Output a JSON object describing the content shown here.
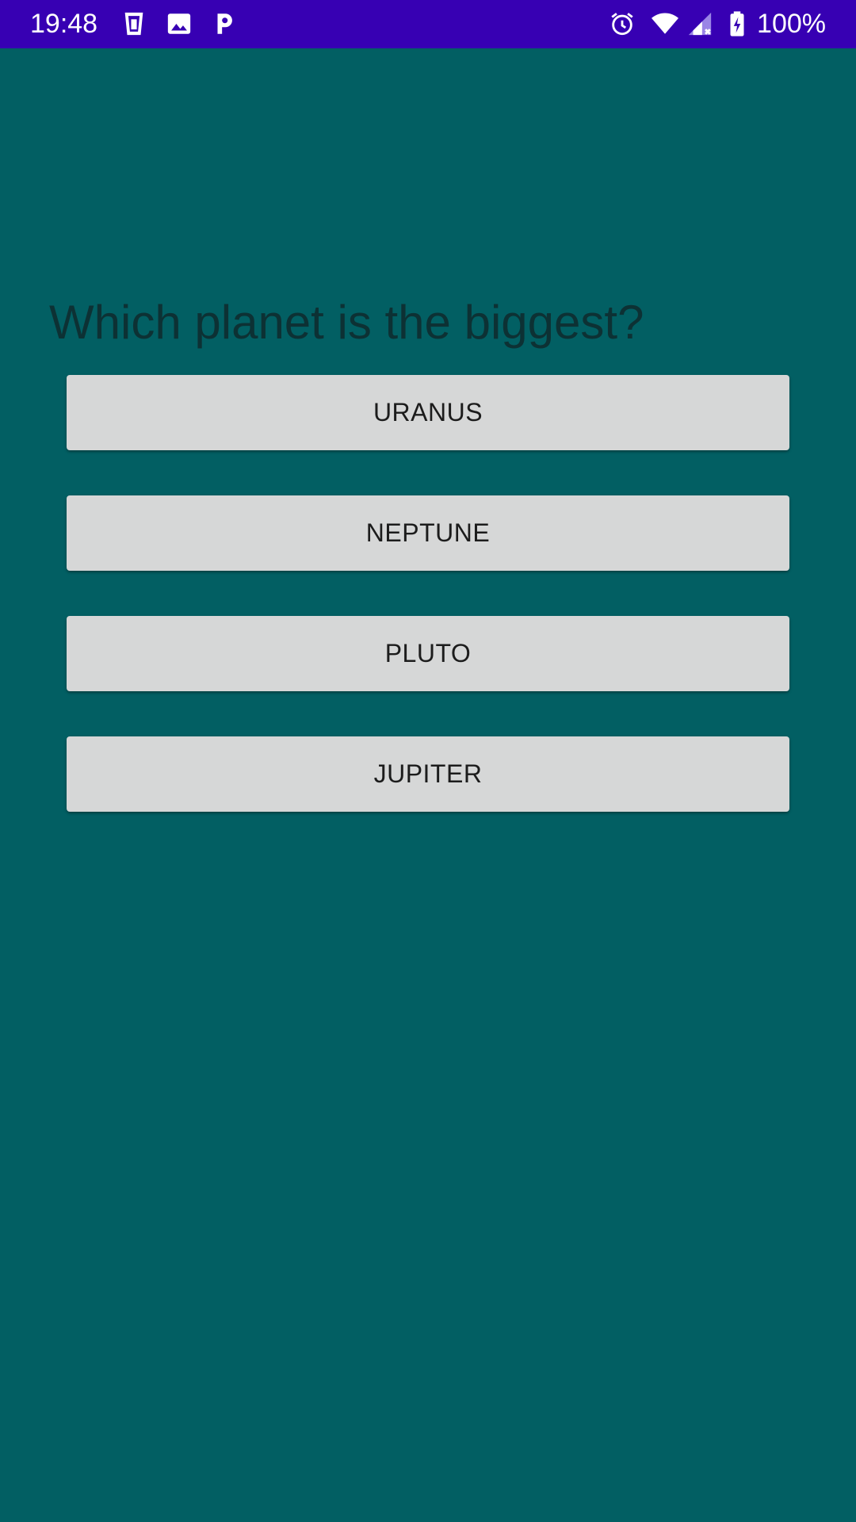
{
  "status_bar": {
    "time": "19:48",
    "battery": "100%",
    "icons": [
      "cup-icon",
      "image-icon",
      "parking-icon",
      "alarm-icon",
      "wifi-icon",
      "signal-icon",
      "battery-icon"
    ]
  },
  "quiz": {
    "question": "Which planet is the biggest?",
    "answers": [
      {
        "label": "URANUS"
      },
      {
        "label": "NEPTUNE"
      },
      {
        "label": "PLUTO"
      },
      {
        "label": "JUPITER"
      }
    ]
  },
  "colors": {
    "status_bar": "#3700b3",
    "background": "#025f63",
    "button": "#d6d7d7",
    "question_text": "#0d3134"
  }
}
